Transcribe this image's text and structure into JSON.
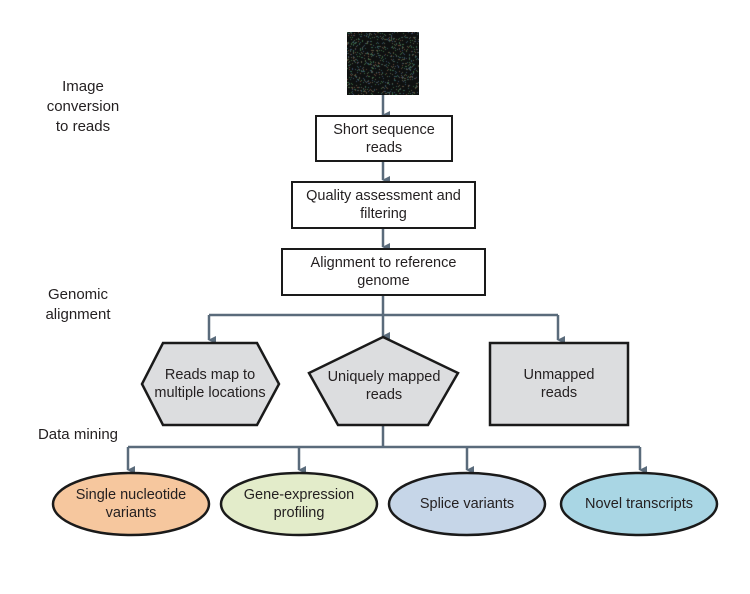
{
  "stages": {
    "image_conversion": "Image\nconversion\nto reads",
    "genomic_alignment": "Genomic\nalignment",
    "data_mining": "Data mining"
  },
  "nodes": {
    "short_reads": "Short sequence reads",
    "quality": "Quality assessment and filtering",
    "alignment": "Alignment to reference genome",
    "multi_map": "Reads map to multiple locations",
    "unique_map": "Uniquely mapped reads",
    "unmapped": "Unmapped reads"
  },
  "outputs": [
    {
      "label": "Single nucleotide variants",
      "color": "#f6c79e"
    },
    {
      "label": "Gene-expression profiling",
      "color": "#e3ecca"
    },
    {
      "label": "Splice variants",
      "color": "#c6d6e8"
    },
    {
      "label": "Novel transcripts",
      "color": "#a9d6e4"
    }
  ],
  "colors": {
    "connector": "#5a6b7b",
    "shape_fill": "#dcdddf",
    "border": "#1a1a1a"
  }
}
